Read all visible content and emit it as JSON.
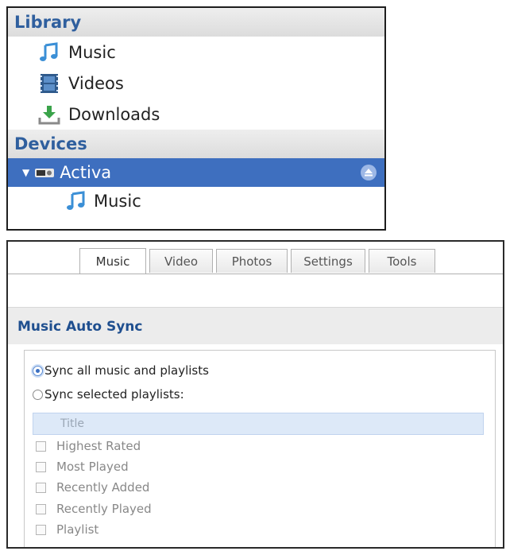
{
  "library": {
    "header": "Library",
    "items": [
      {
        "label": "Music",
        "icon": "music-note-icon"
      },
      {
        "label": "Videos",
        "icon": "film-strip-icon"
      },
      {
        "label": "Downloads",
        "icon": "download-arrow-icon"
      }
    ]
  },
  "devices": {
    "header": "Devices",
    "device": {
      "label": "Activa",
      "icon": "media-player-device-icon",
      "eject_icon": "eject-icon",
      "expand_icon": "expanded-triangle-icon"
    },
    "children": [
      {
        "label": "Music",
        "icon": "music-note-icon"
      }
    ]
  },
  "tabs": [
    {
      "label": "Music",
      "active": true
    },
    {
      "label": "Video",
      "active": false
    },
    {
      "label": "Photos",
      "active": false
    },
    {
      "label": "Settings",
      "active": false
    },
    {
      "label": "Tools",
      "active": false
    }
  ],
  "auto_sync": {
    "title": "Music Auto Sync",
    "options": [
      {
        "label": "Sync all music and playlists",
        "selected": true
      },
      {
        "label": "Sync selected playlists:",
        "selected": false
      }
    ],
    "list_header": "Title",
    "playlists": [
      "Highest Rated",
      "Most Played",
      "Recently Added",
      "Recently Played",
      "Playlist"
    ]
  },
  "colors": {
    "section_header_text": "#2f5f9e",
    "selected_row": "#3e6fbf",
    "title_blue": "#1f4f8f",
    "list_header_bg": "#dde9f8"
  }
}
